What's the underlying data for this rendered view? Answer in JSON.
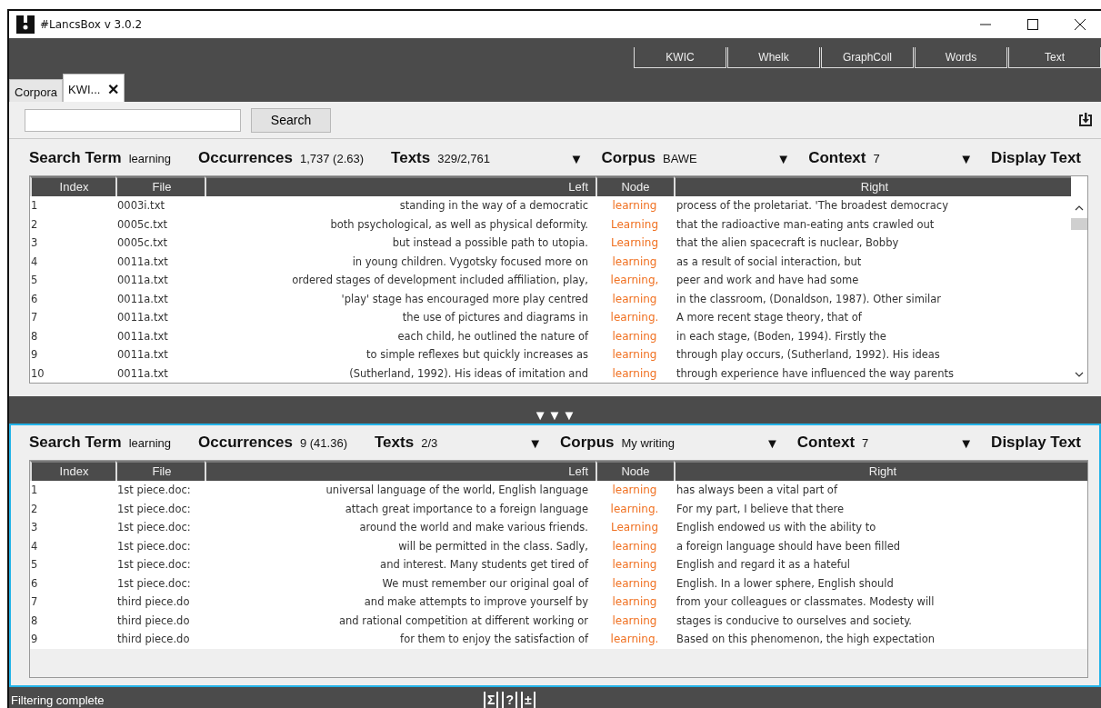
{
  "window": {
    "title": "#LancsBox v 3.0.2"
  },
  "tools": [
    {
      "label": "KWIC"
    },
    {
      "label": "Whelk"
    },
    {
      "label": "GraphColl"
    },
    {
      "label": "Words"
    },
    {
      "label": "Text"
    }
  ],
  "tabs": [
    {
      "label": "Corpora",
      "selected": false
    },
    {
      "label": "KWI...",
      "selected": true,
      "close": "✕"
    }
  ],
  "search": {
    "button": "Search"
  },
  "divider": "▼▼▼",
  "panels": [
    {
      "selected": false,
      "has_scrollbar": true,
      "fields": [
        {
          "label": "Search Term",
          "value": "learning"
        },
        {
          "label": "Occurrences",
          "value": "1,737 (2.63)"
        },
        {
          "label": "Texts",
          "value": "329/2,761"
        },
        {
          "dropdown": "▼",
          "label": "Corpus",
          "value": "BAWE"
        },
        {
          "dropdown": "▼",
          "label": "Context",
          "value": "7"
        },
        {
          "dropdown": "▼",
          "label": "Display Text"
        }
      ],
      "columns": [
        "Index",
        "File",
        "Left",
        "Node",
        "Right"
      ],
      "rows": [
        {
          "index": "1",
          "file": "0003i.txt",
          "left": "standing in the way of a democratic",
          "node": "learning",
          "right": "process of the proletariat. 'The broadest democracy"
        },
        {
          "index": "2",
          "file": "0005c.txt",
          "left": "both psychological, as well as physical deformity.",
          "node": "Learning",
          "right": "that the radioactive man-eating ants crawled out"
        },
        {
          "index": "3",
          "file": "0005c.txt",
          "left": "but instead a possible path to utopia.",
          "node": "Learning",
          "right": "that the alien spacecraft is nuclear, Bobby"
        },
        {
          "index": "4",
          "file": "0011a.txt",
          "left": "in young children. Vygotsky focused more on",
          "node": "learning",
          "right": "as a result of social interaction, but"
        },
        {
          "index": "5",
          "file": "0011a.txt",
          "left": "ordered stages of development included affiliation, play,",
          "node": "learning,",
          "right": "peer and work and have had some"
        },
        {
          "index": "6",
          "file": "0011a.txt",
          "left": "'play' stage has encouraged more play centred",
          "node": "learning",
          "right": "in the classroom, (Donaldson, 1987). Other similar"
        },
        {
          "index": "7",
          "file": "0011a.txt",
          "left": "the use of pictures and diagrams in",
          "node": "learning.",
          "right": "A more recent stage theory, that of"
        },
        {
          "index": "8",
          "file": "0011a.txt",
          "left": "each child, he outlined the nature of",
          "node": "learning",
          "right": "in each stage, (Boden, 1994). Firstly the"
        },
        {
          "index": "9",
          "file": "0011a.txt",
          "left": "to simple reflexes but quickly increases as",
          "node": "learning",
          "right": "through play occurs, (Sutherland, 1992). His ideas"
        },
        {
          "index": "10",
          "file": "0011a.txt",
          "left": "(Sutherland, 1992). His ideas of imitation and",
          "node": "learning",
          "right": "through experience have influenced the way parents"
        }
      ]
    },
    {
      "selected": true,
      "has_scrollbar": false,
      "fields": [
        {
          "label": "Search Term",
          "value": "learning"
        },
        {
          "label": "Occurrences",
          "value": "9 (41.36)"
        },
        {
          "label": "Texts",
          "value": "2/3"
        },
        {
          "dropdown": "▼",
          "label": "Corpus",
          "value": "My writing"
        },
        {
          "dropdown": "▼",
          "label": "Context",
          "value": "7"
        },
        {
          "dropdown": "▼",
          "label": "Display Text"
        }
      ],
      "columns": [
        "Index",
        "File",
        "Left",
        "Node",
        "Right"
      ],
      "rows": [
        {
          "index": "1",
          "file": "1st piece.doc:",
          "left": "universal language of the world, English language",
          "node": "learning",
          "right": "has always been a vital part of"
        },
        {
          "index": "2",
          "file": "1st piece.doc:",
          "left": "attach great importance to a foreign language",
          "node": "learning.",
          "right": "For my part, I believe that there"
        },
        {
          "index": "3",
          "file": "1st piece.doc:",
          "left": "around the world and make various friends.",
          "node": "Learning",
          "right": "English endowed us with the ability to"
        },
        {
          "index": "4",
          "file": "1st piece.doc:",
          "left": "will be permitted in the class. Sadly,",
          "node": "learning",
          "right": "a foreign language should have been filled"
        },
        {
          "index": "5",
          "file": "1st piece.doc:",
          "left": "and interest. Many students get tired of",
          "node": "learning",
          "right": "English and regard it as a hateful"
        },
        {
          "index": "6",
          "file": "1st piece.doc:",
          "left": "We must remember our original goal of",
          "node": "learning",
          "right": "English. In a lower sphere, English should"
        },
        {
          "index": "7",
          "file": "third piece.do",
          "left": "and make attempts to improve yourself by",
          "node": "learning",
          "right": "from your colleagues or classmates. Modesty will"
        },
        {
          "index": "8",
          "file": "third piece.do",
          "left": "and rational competition at different working or",
          "node": "learning",
          "right": "stages is conducive to ourselves and society."
        },
        {
          "index": "9",
          "file": "third piece.do",
          "left": "for them to enjoy the satisfaction of",
          "node": "learning.",
          "right": "Based on this phenomenon, the high expectation"
        }
      ]
    }
  ],
  "status_bar": {
    "text": "Filtering complete",
    "buttons": [
      "Σ",
      "?",
      "±"
    ]
  }
}
